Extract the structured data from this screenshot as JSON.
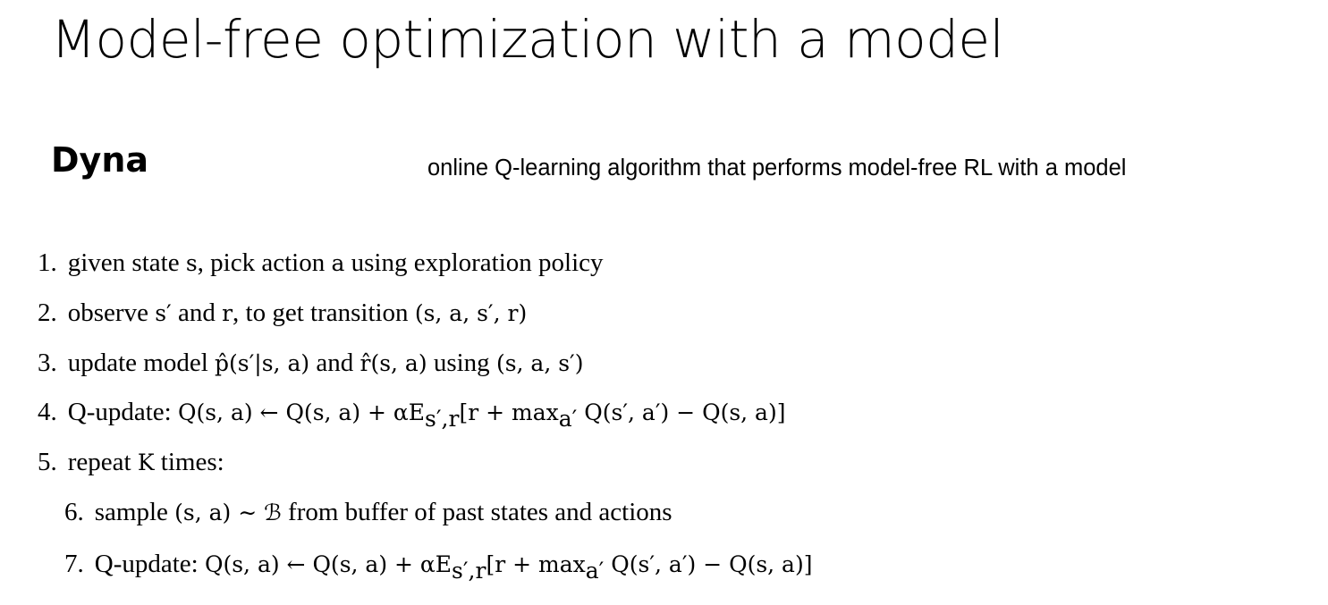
{
  "slide": {
    "title": "Model-free optimization with a model"
  },
  "section": {
    "heading": "Dyna",
    "subtitle": "online Q-learning algorithm that performs model-free RL with a model"
  },
  "steps": [
    {
      "number": "1.",
      "text_pre": "given state ",
      "math1": "s",
      "text_mid": ", pick action ",
      "math2": "a",
      "text_post": " using exploration policy"
    },
    {
      "number": "2.",
      "text_pre": "observe ",
      "math1": "s′",
      "text_mid": " and ",
      "math2": "r",
      "text_post": ", to get transition ",
      "math3": "(s, a, s′, r)"
    },
    {
      "number": "3.",
      "text_pre": "update model ",
      "math1": "p̂(s′|s, a)",
      "text_mid": " and ",
      "math2": "r̂(s, a)",
      "text_post": " using ",
      "math3": "(s, a, s′)"
    },
    {
      "number": "4.",
      "text_pre": "Q-update: ",
      "math1": "Q(s, a) ← Q(s, a) + αE",
      "sub1": "s′,r",
      "math2": "[r + max",
      "sub2": "a′",
      "math3": " Q(s′, a′) − Q(s, a)]"
    },
    {
      "number": "5.",
      "text_pre": "repeat ",
      "math1": "K",
      "text_post": " times:"
    },
    {
      "number": "6.",
      "text_pre": "sample ",
      "math1": "(s, a) ∼ ℬ",
      "text_post": " from buffer of past states and actions"
    },
    {
      "number": "7.",
      "text_pre": "Q-update: ",
      "math1": "Q(s, a) ← Q(s, a) + αE",
      "sub1": "s′,r",
      "math2": "[r + max",
      "sub2": "a′",
      "math3": " Q(s′, a′) − Q(s, a)]"
    }
  ]
}
